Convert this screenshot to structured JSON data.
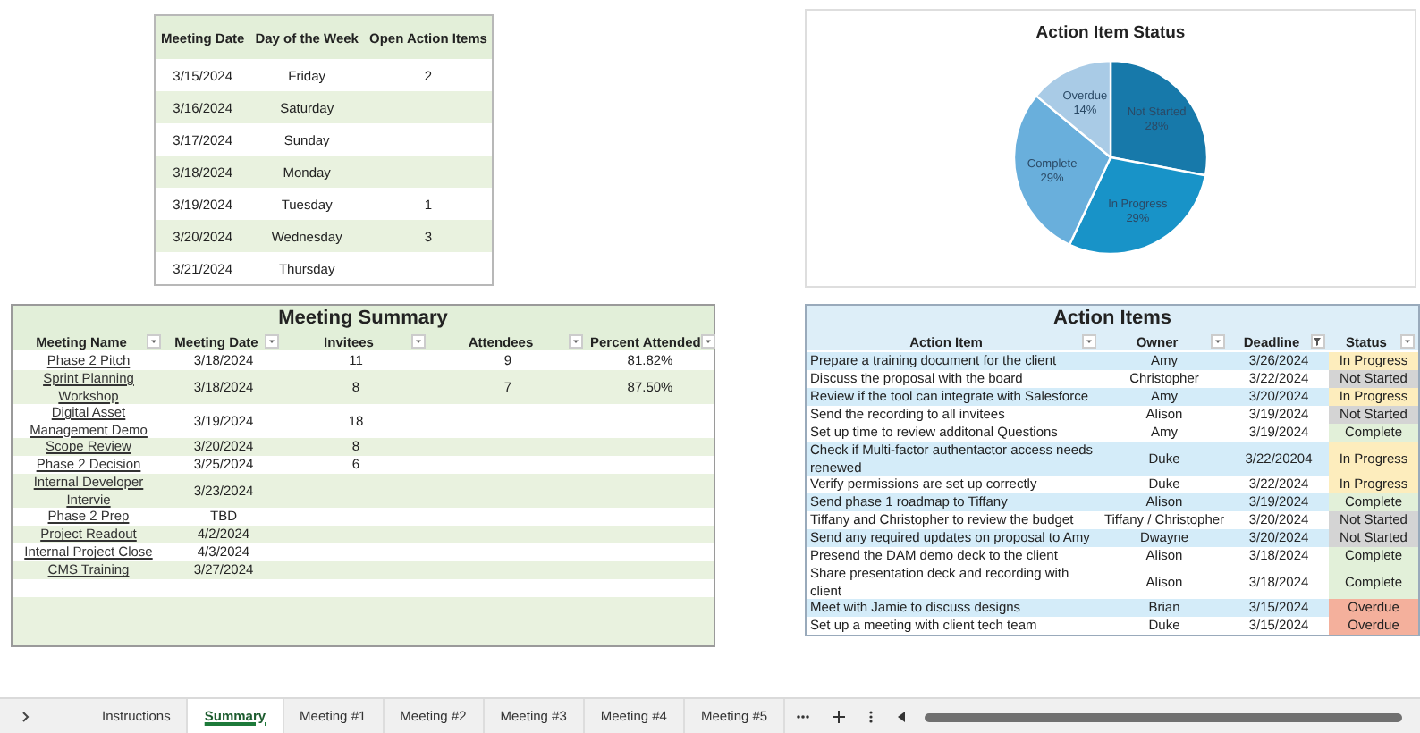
{
  "schedule": {
    "columns": [
      "Meeting Date",
      "Day of the Week",
      "Open Action Items"
    ],
    "rows": [
      {
        "date": "3/15/2024",
        "day": "Friday",
        "open_items": "2"
      },
      {
        "date": "3/16/2024",
        "day": "Saturday"
      },
      {
        "date": "3/17/2024",
        "day": "Sunday"
      },
      {
        "date": "3/18/2024",
        "day": "Monday"
      },
      {
        "date": "3/19/2024",
        "day": "Tuesday",
        "open_items": "1"
      },
      {
        "date": "3/20/2024",
        "day": "Wednesday",
        "open_items": "3"
      },
      {
        "date": "3/21/2024",
        "day": "Thursday"
      }
    ]
  },
  "status_chart": {
    "chart_data": {
      "type": "pie",
      "title": "Action Item Status",
      "categories": [
        "Not Started",
        "In Progress",
        "Complete",
        "Overdue"
      ],
      "data_labels": true,
      "values": [
        28,
        29,
        29,
        14
      ],
      "value_labels": [
        "28%",
        "29%",
        "29%",
        "14%"
      ],
      "colors": [
        "#1779aa",
        "#1893c8",
        "#69afdc",
        "#a9cbe6"
      ]
    }
  },
  "meeting_summary": {
    "title": "Meeting Summary",
    "columns": [
      "Meeting Name",
      "Meeting Date",
      "Invitees",
      "Attendees",
      "Percent Attended"
    ],
    "rows": [
      {
        "name": "Phase 2 Pitch",
        "date": "3/18/2024",
        "invitees": "11",
        "attendees": "9",
        "percent": "81.82%"
      },
      {
        "name": "Sprint Planning Workshop",
        "date": "3/18/2024",
        "invitees": "8",
        "attendees": "7",
        "percent": "87.50%"
      },
      {
        "name": "Digital Asset Management Demo",
        "date": "3/19/2024",
        "invitees": "18"
      },
      {
        "name": "Scope Review",
        "date": "3/20/2024",
        "invitees": "8"
      },
      {
        "name": "Phase 2 Decision",
        "date": "3/25/2024",
        "invitees": "6"
      },
      {
        "name": "Internal Developer Intervie",
        "date": "3/23/2024"
      },
      {
        "name": "Phase 2 Prep",
        "date": "TBD"
      },
      {
        "name": "Project Readout",
        "date": "4/2/2024"
      },
      {
        "name": "Internal Project Close",
        "date": "4/3/2024"
      },
      {
        "name": "CMS Training",
        "date": "3/27/2024"
      }
    ]
  },
  "action_items": {
    "title": "Action Items",
    "columns": [
      {
        "label": "Action Item",
        "filtered": false
      },
      {
        "label": "Owner",
        "filtered": false
      },
      {
        "label": "Deadline",
        "filtered": true
      },
      {
        "label": "Status",
        "filtered": false
      }
    ],
    "rows": [
      {
        "item": "Prepare a training document for the client",
        "owner": "Amy",
        "deadline": "3/26/2024",
        "status": "In Progress",
        "kind": "in_progress",
        "shaded": true
      },
      {
        "item": "Discuss the proposal with the board",
        "owner": "Christopher",
        "deadline": "3/22/2024",
        "status": "Not Started",
        "kind": "not_started",
        "shaded": false
      },
      {
        "item": "Review if the tool can integrate with Salesforce",
        "owner": "Amy",
        "deadline": "3/20/2024",
        "status": "In Progress",
        "kind": "in_progress",
        "shaded": true
      },
      {
        "item": "Send the recording to all invitees",
        "owner": "Alison",
        "deadline": "3/19/2024",
        "status": "Not Started",
        "kind": "not_started",
        "shaded": false
      },
      {
        "item": "Set up time to review additonal Questions",
        "owner": "Amy",
        "deadline": "3/19/2024",
        "status": "Complete",
        "kind": "complete",
        "shaded": false
      },
      {
        "item": "Check if Multi-factor authentactor access needs renewed",
        "owner": "Duke",
        "deadline": "3/22/20204",
        "status": "In Progress",
        "kind": "in_progress",
        "shaded": true
      },
      {
        "item": "Verify permissions are set up correctly",
        "owner": "Duke",
        "deadline": "3/22/2024",
        "status": "In Progress",
        "kind": "in_progress",
        "shaded": false
      },
      {
        "item": "Send phase 1 roadmap to Tiffany",
        "owner": "Alison",
        "deadline": "3/19/2024",
        "status": "Complete",
        "kind": "complete",
        "shaded": true
      },
      {
        "item": "Tiffany and Christopher to review the budget",
        "owner": "Tiffany / Christopher",
        "deadline": "3/20/2024",
        "status": "Not Started",
        "kind": "not_started",
        "shaded": false
      },
      {
        "item": "Send any required updates on proposal to Amy",
        "owner": "Dwayne",
        "deadline": "3/20/2024",
        "status": "Not Started",
        "kind": "not_started",
        "shaded": true
      },
      {
        "item": "Presend the DAM demo deck to the client",
        "owner": "Alison",
        "deadline": "3/18/2024",
        "status": "Complete",
        "kind": "complete",
        "shaded": false
      },
      {
        "item": "Share presentation deck and recording with client",
        "owner": "Alison",
        "deadline": "3/18/2024",
        "status": "Complete",
        "kind": "complete",
        "shaded": false
      },
      {
        "item": "Meet with Jamie to discuss designs",
        "owner": "Brian",
        "deadline": "3/15/2024",
        "status": "Overdue",
        "kind": "overdue",
        "shaded": true
      },
      {
        "item": "Set up a meeting with client tech team",
        "owner": "Duke",
        "deadline": "3/15/2024",
        "status": "Overdue",
        "kind": "overdue",
        "shaded": false
      }
    ]
  },
  "sheet_tabs": [
    {
      "label": "Instructions",
      "selected": false
    },
    {
      "label": "Summary",
      "selected": true
    },
    {
      "label": "Meeting #1",
      "selected": false
    },
    {
      "label": "Meeting #2",
      "selected": false
    },
    {
      "label": "Meeting #3",
      "selected": false
    },
    {
      "label": "Meeting #4",
      "selected": false
    },
    {
      "label": "Meeting #5",
      "selected": false
    }
  ]
}
